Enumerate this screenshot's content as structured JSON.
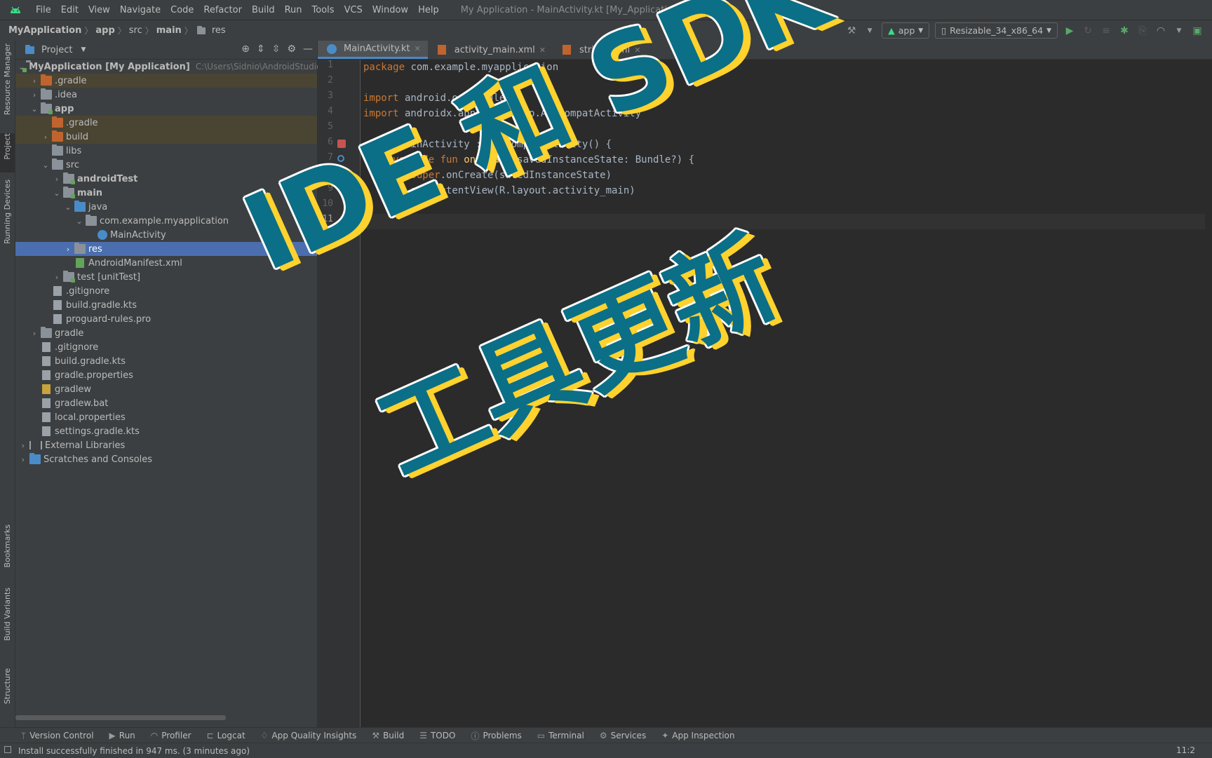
{
  "menubar": {
    "items": [
      "File",
      "Edit",
      "View",
      "Navigate",
      "Code",
      "Refactor",
      "Build",
      "Run",
      "Tools",
      "VCS",
      "Window",
      "Help"
    ],
    "window_title": "My Application - MainActivity.kt [My_Application.app.main]"
  },
  "breadcrumb": [
    "MyApplication",
    "app",
    "src",
    "main",
    "res"
  ],
  "toolbar": {
    "run_config": "app",
    "device": "Resizable_34_x86_64"
  },
  "left_stripe": [
    "Resource Manager",
    "Project",
    "Running Devices",
    "Bookmarks",
    "Build Variants",
    "Structure"
  ],
  "project_panel": {
    "title": "Project",
    "root_label": "MyApplication [My Application]",
    "root_path": "C:\\Users\\Sidnio\\AndroidStudioPr",
    "items": [
      ".gradle",
      ".idea",
      "app",
      ".gradle",
      "build",
      "libs",
      "src",
      "androidTest",
      "main",
      "java",
      "com.example.myapplication",
      "MainActivity",
      "res",
      "AndroidManifest.xml",
      "test [unitTest]",
      ".gitignore",
      "build.gradle.kts",
      "proguard-rules.pro",
      "gradle",
      ".gitignore",
      "build.gradle.kts",
      "gradle.properties",
      "gradlew",
      "gradlew.bat",
      "local.properties",
      "settings.gradle.kts",
      "External Libraries",
      "Scratches and Consoles"
    ]
  },
  "tabs": [
    "MainActivity.kt",
    "activity_main.xml",
    "strings.xml"
  ],
  "editor": {
    "line_numbers": [
      "1",
      "2",
      "3",
      "4",
      "5",
      "6",
      "7",
      "8",
      "9",
      "10",
      "11"
    ],
    "lines": [
      {
        "kw": "package",
        "rest": " com.example.myapplication",
        "fn": "",
        "tail": ""
      },
      {
        "kw": "",
        "rest": "",
        "fn": "",
        "tail": ""
      },
      {
        "kw": "import",
        "rest": " android.os.Bundle",
        "fn": "",
        "tail": ""
      },
      {
        "kw": "import",
        "rest": " androidx.appcompat.app.AppCompatActivity",
        "fn": "",
        "tail": ""
      },
      {
        "kw": "",
        "rest": "",
        "fn": "",
        "tail": ""
      },
      {
        "kw": "class",
        "rest": " MainActivity : AppCompatActivity() {",
        "fn": "",
        "tail": ""
      },
      {
        "kw": "    override fun",
        "rest": " ",
        "fn": "onCreate",
        "tail": "(savedInstanceState: Bundle?) {"
      },
      {
        "kw": "        super",
        "rest": ".onCreate(savedInstanceState)",
        "fn": "",
        "tail": ""
      },
      {
        "kw": "",
        "rest": "        setContentView(R.layout.activity_main)",
        "fn": "",
        "tail": ""
      },
      {
        "kw": "",
        "rest": "    }",
        "fn": "",
        "tail": ""
      },
      {
        "kw": "",
        "rest": "}",
        "fn": "",
        "tail": ""
      }
    ]
  },
  "overlay": {
    "line1": "IDE 和 SDK",
    "line2": "工具更新",
    "colors": {
      "fill": "#0b6f87",
      "shadow": "#ffd22e",
      "outline": "#ffffff"
    }
  },
  "bottom_tools": [
    "Version Control",
    "Run",
    "Profiler",
    "Logcat",
    "App Quality Insights",
    "Build",
    "TODO",
    "Problems",
    "Terminal",
    "Services",
    "App Inspection"
  ],
  "status": {
    "message": "Install successfully finished in 947 ms. (3 minutes ago)",
    "position": "11:2"
  }
}
